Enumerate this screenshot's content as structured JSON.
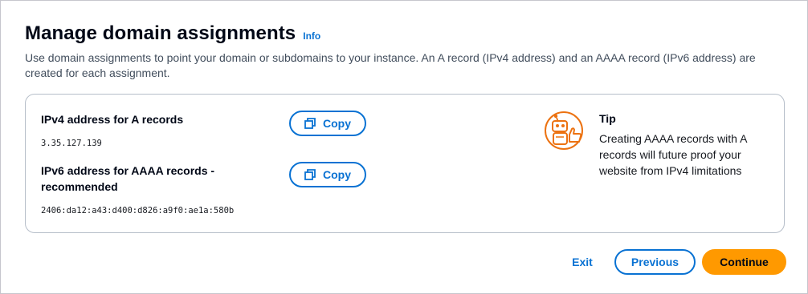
{
  "header": {
    "title": "Manage domain assignments",
    "info_label": "Info",
    "description": "Use domain assignments to point your domain or subdomains to your instance. An A record (IPv4 address) and an AAAA record (IPv6 address) are created for each assignment."
  },
  "panel": {
    "ipv4": {
      "label": "IPv4 address for A records",
      "value": "3.35.127.139",
      "copy_label": "Copy"
    },
    "ipv6": {
      "label": "IPv6 address for AAAA records - recommended",
      "value": "2406:da12:a43:d400:d826:a9f0:ae1a:580b",
      "copy_label": "Copy"
    },
    "tip": {
      "icon": "robot-thumbs-up-icon",
      "title": "Tip",
      "text": "Creating AAAA records with A records will future proof your website from IPv4 limitations"
    }
  },
  "footer": {
    "exit_label": "Exit",
    "previous_label": "Previous",
    "continue_label": "Continue"
  },
  "colors": {
    "link_blue": "#0972d3",
    "primary_orange": "#ff9900",
    "tip_icon_orange": "#ec7211"
  }
}
